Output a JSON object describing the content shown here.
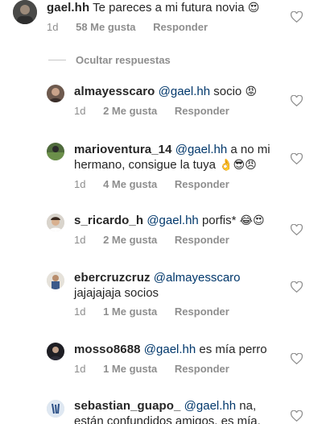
{
  "main_comment": {
    "username": "gael.hh",
    "text": "Te pareces a mi futura novia",
    "emoji": "😍",
    "time": "1d",
    "likes": "58 Me gusta",
    "reply": "Responder"
  },
  "hide_replies_label": "Ocultar respuestas",
  "replies": [
    {
      "username": "almayesscaro",
      "mention": "@gael.hh",
      "text": "socio",
      "emoji": "😡",
      "time": "1d",
      "likes": "2 Me gusta",
      "reply": "Responder"
    },
    {
      "username": "marioventura_14",
      "mention": "@gael.hh",
      "text": "a no mi",
      "text2": "hermano, consigue la tuya",
      "emoji": "👌😎😠",
      "time": "1d",
      "likes": "4 Me gusta",
      "reply": "Responder"
    },
    {
      "username": "s_ricardo_h",
      "mention": "@gael.hh",
      "text": "porfis*",
      "emoji": "😂😍",
      "time": "1d",
      "likes": "2 Me gusta",
      "reply": "Responder"
    },
    {
      "username": "ebercruzcruz",
      "mention": "@almayesscaro",
      "text2": "jajajajaja socios",
      "time": "1d",
      "likes": "1 Me gusta",
      "reply": "Responder"
    },
    {
      "username": "mosso8688",
      "mention": "@gael.hh",
      "text": "es mía perro",
      "time": "1d",
      "likes": "1 Me gusta",
      "reply": "Responder"
    },
    {
      "username": "sebastian_guapo_",
      "mention": "@gael.hh",
      "text": "na,",
      "text2": "están confundidos amigos, es mía."
    }
  ],
  "colors": {
    "text": "#262626",
    "meta": "#8e8e8e",
    "mention": "#00376b",
    "heart_outline": "#8e8e8e"
  },
  "icons": {
    "like": "heart-outline-icon"
  }
}
